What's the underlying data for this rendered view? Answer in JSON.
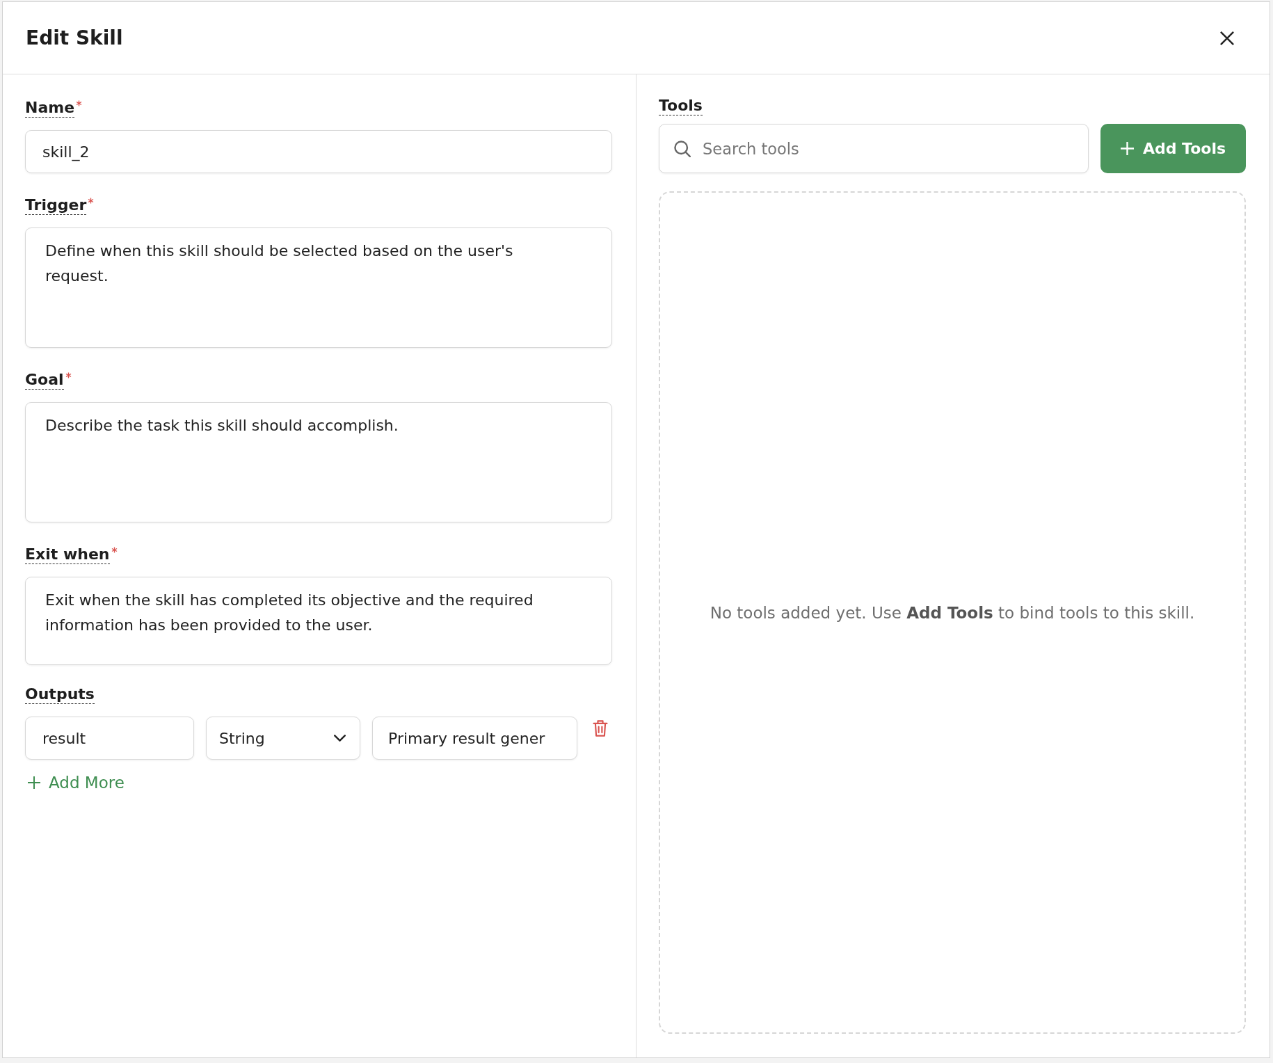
{
  "dialog": {
    "title": "Edit Skill"
  },
  "form": {
    "fields": [
      {
        "kind": "input",
        "label": "Name",
        "required": true,
        "value": "skill_2"
      },
      {
        "kind": "textarea",
        "label": "Trigger",
        "required": true,
        "value": "Define when this skill should be selected based on the user's request."
      },
      {
        "kind": "textarea",
        "label": "Goal",
        "required": true,
        "value": "Describe the task this skill should accomplish."
      },
      {
        "kind": "textarea",
        "label": "Exit when",
        "required": true,
        "value": "Exit when the skill has completed its objective and the required information has been provided to the user."
      }
    ]
  },
  "outputs": {
    "label": "Outputs",
    "required": false,
    "rows": [
      {
        "name": "result",
        "type": "String",
        "description": "Primary result gener"
      }
    ],
    "add_button": "Add More"
  },
  "tools": {
    "label": "Tools",
    "required": false,
    "search": {
      "placeholder": "Search tools"
    },
    "add_button": "Add Tools",
    "empty_message": "No tools added yet. Use **Add Tools** to bind tools to this skill."
  }
}
